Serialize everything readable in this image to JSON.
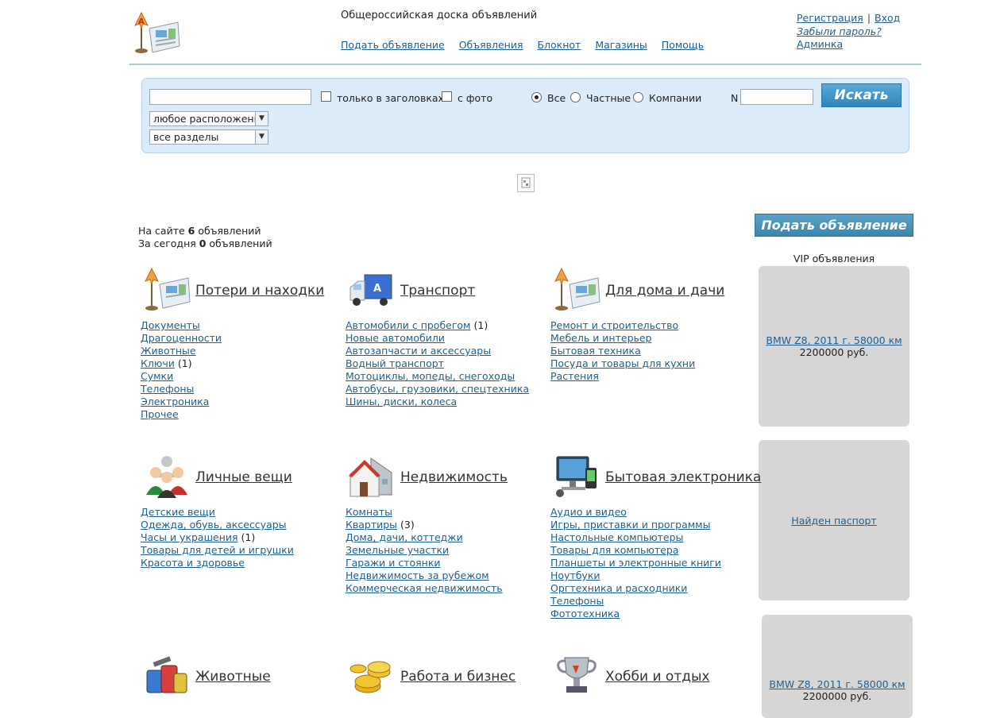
{
  "header": {
    "site_title": "Общероссийская доска объявлений",
    "nav": [
      "Подать объявление",
      "Объявления",
      "Блокнот",
      "Магазины",
      "Помощь"
    ],
    "register": "Регистрация",
    "sep": "|",
    "login": "Вход",
    "forgot": "Забыли пароль?",
    "admin": "Админка"
  },
  "search": {
    "titles_only": "только в заголовках",
    "with_photo": "с фото",
    "radio_all": "Все",
    "radio_private": "Частные",
    "radio_companies": "Компании",
    "n_label": "N",
    "button": "Искать",
    "location_select": "любое расположение",
    "section_select": "все разделы"
  },
  "stats": {
    "line1_pre": "На сайте ",
    "line1_num": "6",
    "line1_post": " объявлений",
    "line2_pre": "За сегодня ",
    "line2_num": "0",
    "line2_post": " объявлений"
  },
  "post_button": "Подать объявление",
  "vip": {
    "title": "VIP объявления",
    "cards": [
      {
        "title": "BMW Z8, 2011 г. 58000 км",
        "price": "2200000 руб."
      },
      {
        "title": "Найден паспорт",
        "price": ""
      },
      {
        "title": "BMW Z8, 2011 г. 58000 км",
        "price": "2200000 руб."
      }
    ]
  },
  "categories": [
    {
      "title": "Потери и находки",
      "icon": "board-pin-icon",
      "subs": [
        [
          "Документы",
          ""
        ],
        [
          "Драгоценности",
          ""
        ],
        [
          "Животные",
          ""
        ],
        [
          "Ключи",
          "(1)"
        ],
        [
          "Сумки",
          ""
        ],
        [
          "Телефоны",
          ""
        ],
        [
          "Электроника",
          ""
        ],
        [
          "Прочее",
          ""
        ]
      ]
    },
    {
      "title": "Транспорт",
      "icon": "truck-icon",
      "subs": [
        [
          "Автомобили с пробегом",
          "(1)"
        ],
        [
          "Новые автомобили",
          ""
        ],
        [
          "Автозапчасти и аксессуары",
          ""
        ],
        [
          "Водный транспорт",
          ""
        ],
        [
          "Мотоциклы, мопеды, снегоходы",
          ""
        ],
        [
          "Автобусы, грузовики, спецтехника",
          ""
        ],
        [
          "Шины, диски, колеса",
          ""
        ]
      ]
    },
    {
      "title": "Для дома и дачи",
      "icon": "board-pin-icon",
      "subs": [
        [
          "Ремонт и строительство",
          ""
        ],
        [
          "Мебель и интерьер",
          ""
        ],
        [
          "Бытовая техника",
          ""
        ],
        [
          "Посуда и товары для кухни",
          ""
        ],
        [
          "Растения",
          ""
        ]
      ]
    },
    {
      "title": "Личные вещи",
      "icon": "people-icon",
      "subs": [
        [
          "Детские вещи",
          ""
        ],
        [
          "Одежда, обувь, аксессуары",
          ""
        ],
        [
          "Часы и украшения",
          "(1)"
        ],
        [
          "Товары для детей и игрушки",
          ""
        ],
        [
          "Красота и здоровье",
          ""
        ]
      ]
    },
    {
      "title": "Недвижимость",
      "icon": "house-icon",
      "subs": [
        [
          "Комнаты",
          ""
        ],
        [
          "Квартиры",
          "(3)"
        ],
        [
          "Дома, дачи, коттеджи",
          ""
        ],
        [
          "Земельные участки",
          ""
        ],
        [
          "Гаражи и стоянки",
          ""
        ],
        [
          "Недвижимость за рубежом",
          ""
        ],
        [
          "Коммерческая недвижимость",
          ""
        ]
      ]
    },
    {
      "title": "Бытовая электроника",
      "icon": "computer-icon",
      "subs": [
        [
          "Аудио и видео",
          ""
        ],
        [
          "Игры, приставки и программы",
          ""
        ],
        [
          "Настольные компьютеры",
          ""
        ],
        [
          "Товары для компьютера",
          ""
        ],
        [
          "Планшеты и электронные книги",
          ""
        ],
        [
          "Ноутбуки",
          ""
        ],
        [
          "Оргтехника и расходники",
          ""
        ],
        [
          "Телефоны",
          ""
        ],
        [
          "Фототехника",
          ""
        ]
      ]
    },
    {
      "title": "Животные",
      "icon": "paint-cans-icon",
      "subs": []
    },
    {
      "title": "Работа и бизнес",
      "icon": "coins-icon",
      "subs": []
    },
    {
      "title": "Хобби и отдых",
      "icon": "trophy-icon",
      "subs": []
    }
  ]
}
